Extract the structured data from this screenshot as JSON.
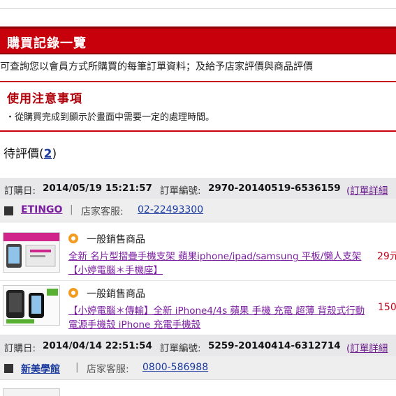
{
  "page": {
    "title": "購買記錄一覽",
    "description": "可查詢您以會員方式所購買的每筆訂單資料；及給予店家評價與商品評價"
  },
  "notice": {
    "title": "使用注意事項",
    "item": "・從購買完成到顯示於畫面中需要一定的處理時間。"
  },
  "pending": {
    "label": "待評價",
    "open": "(",
    "count": "2",
    "close": ")"
  },
  "orders": [
    {
      "date_label": "訂購日:",
      "date": "2014/05/19 15:21:57",
      "order_label": "訂單編號:",
      "order_no": "2970-20140519-6536159",
      "detail_open": "(",
      "detail_link": "訂單詳細",
      "store": "ETINGO",
      "store_color": "#7a1ea0",
      "sep": "|",
      "service_label": "店家客服:",
      "phone": "02-22493300",
      "items": [
        {
          "type": "一般銷售商品",
          "name": "全新 名片型摺疊手機支架 蘋果iphone/ipad/samsung 平板/懶人支架【小婷電腦＊手機座】",
          "price": "29元"
        },
        {
          "type": "一般銷售商品",
          "name": "【小婷電腦＊傳輸】全新 iPhone4/4s 蘋果 手機 充電 超薄 背殼式行動電源手機殼 iPhone 充電手機殼",
          "price": "150"
        }
      ]
    },
    {
      "date_label": "訂購日:",
      "date": "2014/04/14 22:51:54",
      "order_label": "訂單編號:",
      "order_no": "5259-20140414-6312714",
      "detail_open": "(",
      "detail_link": "訂單詳細",
      "store": "新美學館",
      "store_color": "#1a3a9e",
      "sep": "|",
      "service_label": "店家客服:",
      "phone": "0800-586988",
      "items": []
    }
  ]
}
